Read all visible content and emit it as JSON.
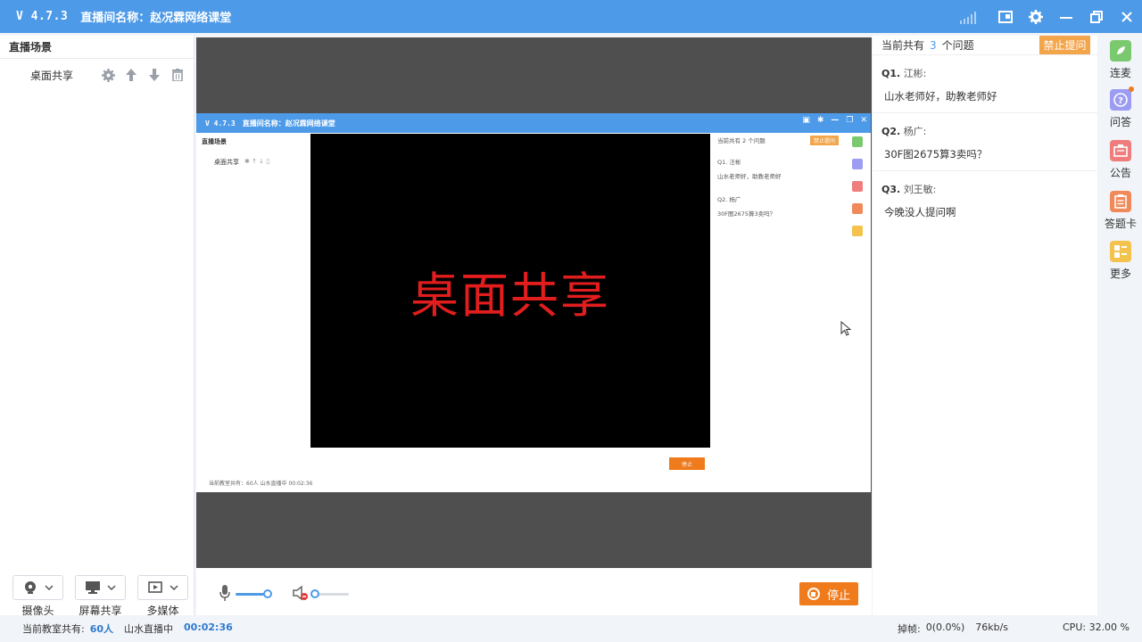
{
  "titlebar": {
    "version": "V 4.7.3",
    "title": "直播间名称：赵况霖网络课堂"
  },
  "left": {
    "header": "直播场景",
    "scene": "桌面共享",
    "devices": [
      {
        "label": "摄像头",
        "icon": "camera-icon"
      },
      {
        "label": "屏幕共享",
        "icon": "monitor-icon"
      },
      {
        "label": "多媒体",
        "icon": "media-icon"
      }
    ]
  },
  "stage": {
    "screen_text": "桌面共享",
    "mini": {
      "version": "V 4.7.3",
      "title": "直播间名称：赵况霖网络课堂",
      "left_header": "直播场景",
      "scene": "桌面共享",
      "qa_head": "当前共有 2 个问题",
      "ban": "禁止提问",
      "q1": "Q1.  汪彬",
      "q1_text": "山水老师好，助教老师好",
      "q2": "Q2.  杨广",
      "q2_text": "30F图2675算3卖吗？",
      "stop": "停止",
      "status": "当前教室共有：60人  山水直播中  00:02:36"
    }
  },
  "controls": {
    "stop_label": "停止"
  },
  "qa": {
    "head_prefix": "当前共有",
    "count": "3",
    "head_suffix": "个问题",
    "ban_label": "禁止提问",
    "questions": [
      {
        "id": "Q1.",
        "name": "江彬:",
        "text": "山水老师好，助教老师好"
      },
      {
        "id": "Q2.",
        "name": "杨广:",
        "text": "30F图2675算3卖吗？"
      },
      {
        "id": "Q3.",
        "name": "刘王敏:",
        "text": "今晚没人提问啊"
      }
    ]
  },
  "sidebar": {
    "items": [
      {
        "label": "连麦",
        "icon": "link-mic-icon",
        "color": "#7bc96f"
      },
      {
        "label": "问答",
        "icon": "question-icon",
        "color": "#9b9cf2"
      },
      {
        "label": "公告",
        "icon": "notice-icon",
        "color": "#ef7d7d"
      },
      {
        "label": "答题卡",
        "icon": "answer-card-icon",
        "color": "#f08a5b"
      },
      {
        "label": "更多",
        "icon": "more-icon",
        "color": "#f4c34e"
      }
    ]
  },
  "status": {
    "room_prefix": "当前教室共有:",
    "count": "60人",
    "state": "山水直播中",
    "time": "00:02:36",
    "drop_label": "掉帧:",
    "drop": "0(0.0%)",
    "bitrate": "76kb/s",
    "cpu": "CPU: 32.00 %"
  }
}
